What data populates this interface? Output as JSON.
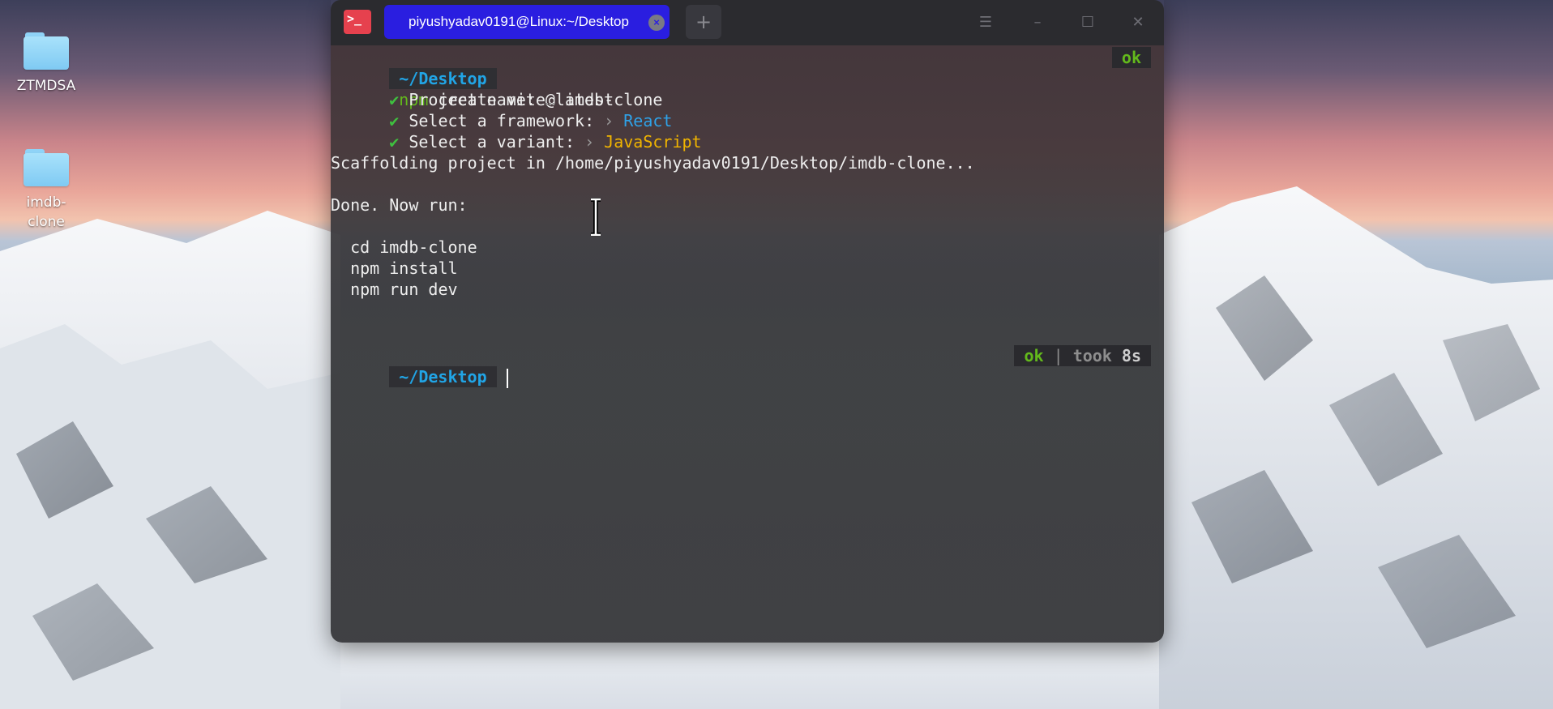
{
  "desktop": {
    "icons": [
      {
        "label": "ZTMDSA"
      },
      {
        "label": "imdb-\nclone"
      }
    ]
  },
  "terminal": {
    "tab_title": "piyushyadav0191@Linux:~/Desktop",
    "new_tab": "+",
    "lines": {
      "prompt1_dir": "~/Desktop",
      "cmd_npm": "npm",
      "cmd_rest": " create vite@latest",
      "status1": "ok",
      "l2_label": " Project name: ",
      "l2_sep": "…",
      "l2_value": " imdb-clone",
      "l3_label": " Select a framework: ",
      "l3_sep": "›",
      "l3_value": " React",
      "l4_label": " Select a variant: ",
      "l4_sep": "›",
      "l4_value": " JavaScript",
      "scaffold": "Scaffolding project in /home/piyushyadav0191/Desktop/imdb-clone...",
      "done": "Done. Now run:",
      "run1": "  cd imdb-clone",
      "run2": "  npm install",
      "run3": "  npm run dev",
      "prompt2_dir": "~/Desktop",
      "status2_ok": "ok",
      "status2_sep": " | ",
      "status2_took": "took ",
      "status2_time": "8s"
    },
    "check_glyph": "✔"
  },
  "colors": {
    "tab_active": "#2a1ee0",
    "prompt_dir": "#21a5e6",
    "ok_green": "#63b91c",
    "react_blue": "#2fa2e8",
    "js_yellow": "#f0b400",
    "app_icon": "#e6414e"
  }
}
